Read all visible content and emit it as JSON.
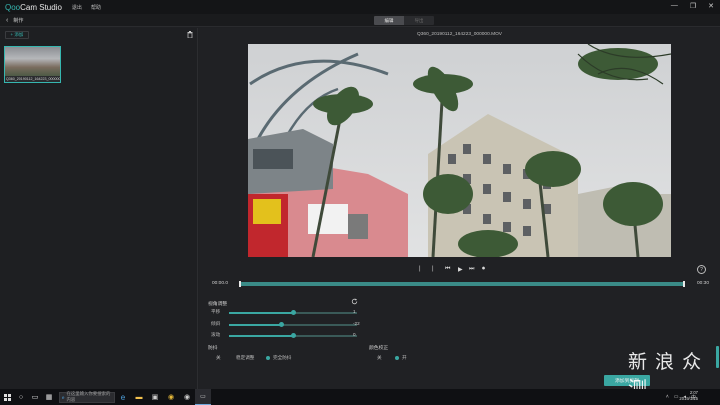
{
  "app": {
    "brand_prefix": "Qoo",
    "brand_suffix": "Cam Studio",
    "menu": [
      "退出",
      "帮助"
    ],
    "window_controls": [
      "—",
      "❐",
      "✕"
    ]
  },
  "subbar": {
    "title": "制作",
    "toggle_a": "编辑",
    "toggle_b": "导出"
  },
  "library": {
    "add_label": "+ 添加",
    "items": [
      {
        "filename": "Q360_20190112_164223_000000.MOV"
      }
    ]
  },
  "player": {
    "filename": "Q360_20190112_164223_000000.MOV",
    "time_current": "00:00.0",
    "time_total": "00:30",
    "progress": 1.0,
    "controls": [
      "|",
      "|",
      "⏮",
      "▶",
      "⏭",
      "⏺"
    ]
  },
  "adjust": {
    "title": "视角调整",
    "rows": [
      {
        "label": "平移",
        "value": "1",
        "level": 0.5
      },
      {
        "label": "倾斜",
        "value": "-22",
        "level": 0.41
      },
      {
        "label": "滚动",
        "value": "0",
        "level": 0.5
      }
    ]
  },
  "stabilize": {
    "title": "防抖",
    "options": [
      "关",
      "稳定调整",
      "完全防抖"
    ],
    "selected": "完全防抖"
  },
  "color": {
    "title": "颜色校正",
    "options": [
      "关",
      "开"
    ],
    "selected": "开"
  },
  "export_button": "添加到剪辑",
  "watermark": "新 浪 众 测",
  "taskbar": {
    "search_placeholder": "在这里输入你要搜索的内容",
    "clock_time": "2:07",
    "clock_date": "2019/1/15"
  }
}
